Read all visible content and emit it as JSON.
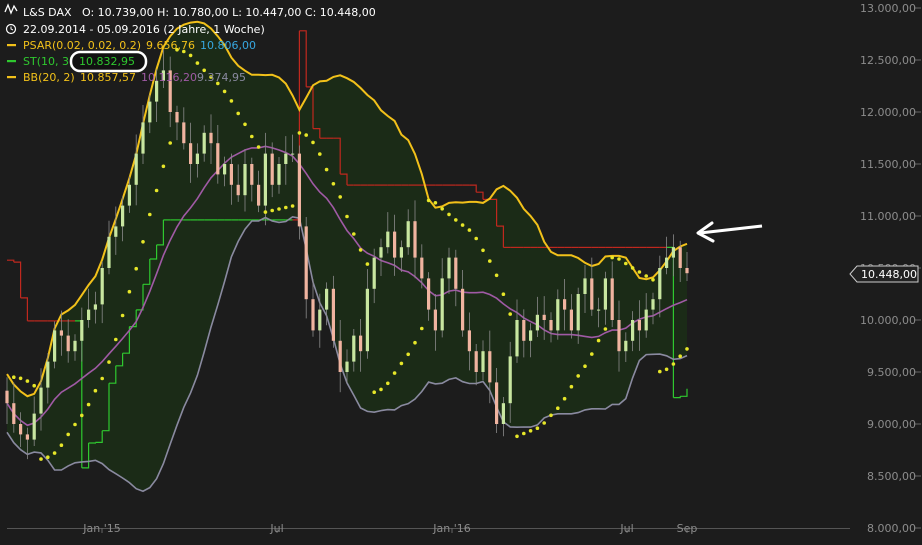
{
  "legend": {
    "symbol": "L&S DAX",
    "ohlc": "O: 10.739,00   H: 10.780,00   L: 10.447,00   C: 10.448,00",
    "period": "22.09.2014 - 05.09.2016 (2 Jahre, 1 Woche)",
    "psar_label": "PSAR(0.02, 0.02, 0.2)",
    "psar_value1": "9.656,76",
    "psar_value2": "10.806,00",
    "st_label": "ST(10, 3)",
    "st_value": "10.832,95",
    "bb_label": "BB(20, 2)",
    "bb_value1": "10.857,57",
    "bb_value2": "10.116,20",
    "bb_value3": "9.374,95"
  },
  "last_price_label": "10.448,00",
  "colors": {
    "background": "#1c1c1c",
    "band_fill": "#1b2b17",
    "bb_upper": "#f2c11a",
    "bb_middle": "#a05aa5",
    "bb_lower": "#8a8aa0",
    "psar": "#e6e629",
    "supertrend_up": "#2fc82f",
    "supertrend_down": "#c0281e",
    "candle_up": "#c8e6a0",
    "candle_down": "#f0b4a0"
  },
  "chart_data": {
    "type": "candlestick",
    "title": "L&S DAX",
    "x_ticks": [
      "Jan '15",
      "Jul",
      "Jan '16",
      "Jul",
      "Sep"
    ],
    "y_ticks": [
      "8.000,00",
      "8.500,00",
      "9.000,00",
      "9.500,00",
      "10.000,00",
      "10.500,00",
      "11.000,00",
      "11.500,00",
      "12.000,00",
      "12.500,00",
      "13.000,00"
    ],
    "ylim": [
      8000,
      13000
    ],
    "grid": false,
    "legend_position": "top-left",
    "series": [
      {
        "name": "L&S DAX",
        "kind": "weekly candles",
        "close": [
          9200,
          9000,
          8900,
          8850,
          9100,
          9350,
          9600,
          9900,
          9850,
          9700,
          9800,
          10000,
          10100,
          10150,
          10500,
          10800,
          10900,
          11100,
          11300,
          11600,
          11900,
          12100,
          12300,
          12400,
          12000,
          11900,
          11700,
          11500,
          11600,
          11800,
          11700,
          11400,
          11500,
          11300,
          11200,
          11500,
          11300,
          11100,
          11600,
          11300,
          11500,
          11600,
          11600,
          10900,
          10200,
          9900,
          10100,
          10300,
          9800,
          9500,
          9600,
          9850,
          9700,
          10300,
          10600,
          10700,
          10850,
          10600,
          10700,
          10950,
          10600,
          10400,
          10100,
          9900,
          10400,
          10600,
          10300,
          9900,
          9700,
          9500,
          9700,
          9400,
          9000,
          9200,
          9650,
          10000,
          9800,
          9900,
          10050,
          10000,
          9900,
          10200,
          10100,
          9900,
          10250,
          10400,
          10100,
          10100,
          10400,
          10000,
          9700,
          9800,
          10000,
          9900,
          10100,
          10200,
          10500,
          10600,
          10700,
          10500,
          10450
        ]
      },
      {
        "name": "PSAR(0.02, 0.02, 0.2)"
      },
      {
        "name": "ST(10, 3)"
      },
      {
        "name": "BB(20, 2)"
      }
    ]
  }
}
